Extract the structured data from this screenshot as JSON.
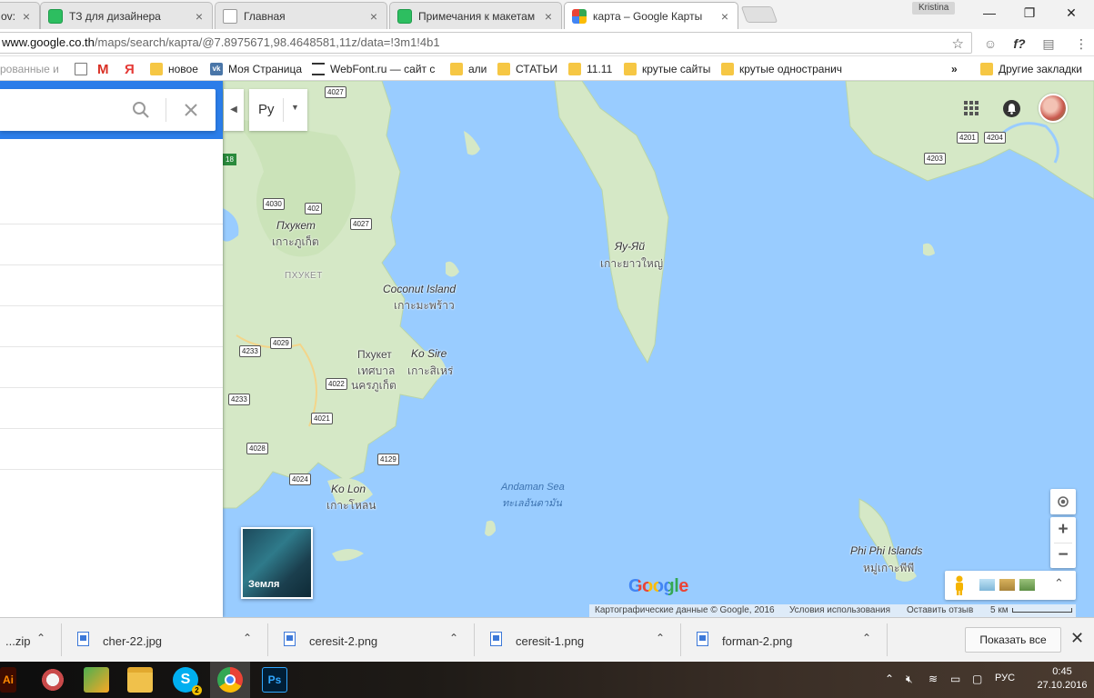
{
  "browser": {
    "tabs": [
      {
        "label": "ov:",
        "icon": "doc-icon"
      },
      {
        "label": "ТЗ для дизайнера",
        "icon": "evernote-icon"
      },
      {
        "label": "Главная",
        "icon": "doc-icon"
      },
      {
        "label": "Примечания к макетам",
        "icon": "evernote-icon"
      },
      {
        "label": "карта – Google Карты",
        "icon": "google-maps-icon",
        "active": true
      }
    ],
    "profile_name": "Kristina",
    "url_host": "www.google.co.th",
    "url_path": "/maps/search/карта/@7.8975671,98.4648581,11z/data=!3m1!4b1",
    "bookmarks": [
      {
        "label": "рованные и",
        "icon": "none"
      },
      {
        "label": "",
        "icon": "page-icon"
      },
      {
        "label": "M",
        "icon": "gmail-icon"
      },
      {
        "label": "Я",
        "icon": "yandex-icon"
      },
      {
        "label": "новое",
        "icon": "folder-icon"
      },
      {
        "label": "Моя Страница",
        "icon": "vk-icon"
      },
      {
        "label": "WebFont.ru — сайт с",
        "icon": "webfont-icon"
      },
      {
        "label": "али",
        "icon": "folder-icon"
      },
      {
        "label": "СТАТЬИ",
        "icon": "folder-icon"
      },
      {
        "label": "11.11",
        "icon": "folder-icon"
      },
      {
        "label": "крутые сайты",
        "icon": "folder-icon"
      },
      {
        "label": "крутые одностранич",
        "icon": "folder-icon"
      }
    ],
    "bookmarks_overflow": "»",
    "other_bookmarks": "Другие закладки"
  },
  "maps": {
    "search_value": "",
    "language_label": "Ру",
    "earth_label": "Земля",
    "google_logo": "Google",
    "attribution": {
      "map_data": "Картографические данные © Google, 2016",
      "terms": "Условия использования",
      "feedback": "Оставить отзыв",
      "scale": "5 км"
    },
    "labels": [
      {
        "text": "Пхукет",
        "style": "it"
      },
      {
        "text": "เกาะภูเก็ต",
        "style": "thai"
      },
      {
        "text": "ПХУКЕТ",
        "style": "prov"
      },
      {
        "text": "Coconut Island",
        "style": "it"
      },
      {
        "text": "เกาะมะพร้าว",
        "style": "thai"
      },
      {
        "text": "Пхукет",
        "style": "plain"
      },
      {
        "text": "เทศบาล",
        "style": "thai"
      },
      {
        "text": "นครภูเก็ต",
        "style": "thai"
      },
      {
        "text": "Ko Sire",
        "style": "it"
      },
      {
        "text": "เกาะสิเหร่",
        "style": "thai"
      },
      {
        "text": "Яу-Яй",
        "style": "it"
      },
      {
        "text": "เกาะยาวใหญ่",
        "style": "thai"
      },
      {
        "text": "Ko Lon",
        "style": "it"
      },
      {
        "text": "เกาะโหลน",
        "style": "thai"
      },
      {
        "text": "Andaman Sea",
        "style": "sea"
      },
      {
        "text": "ทะเลอันดามัน",
        "style": "sea"
      },
      {
        "text": "Phi Phi Islands",
        "style": "it"
      },
      {
        "text": "หมู่เกาะพีพี",
        "style": "thai"
      }
    ],
    "road_shields": [
      "4027",
      "4027",
      "402",
      "4030",
      "4027",
      "4233",
      "4029",
      "4233",
      "4022",
      "4021",
      "4028",
      "4129",
      "4024",
      "4201",
      "4204",
      "4203"
    ],
    "highway_shield": "18"
  },
  "downloads": {
    "items": [
      {
        "name": "...zip"
      },
      {
        "name": "cher-22.jpg"
      },
      {
        "name": "ceresit-2.png"
      },
      {
        "name": "ceresit-1.png"
      },
      {
        "name": "forman-2.png"
      }
    ],
    "show_all": "Показать все"
  },
  "taskbar": {
    "language": "РУС",
    "time": "0:45",
    "date": "27.10.2016",
    "skype_badge": "2"
  }
}
